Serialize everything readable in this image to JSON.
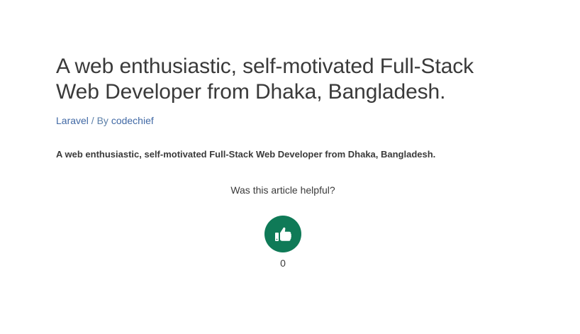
{
  "article": {
    "title": "A web enthusiastic, self-motivated Full-Stack Web Developer from Dhaka, Bangladesh.",
    "category": "Laravel",
    "separator": " / By ",
    "author": "codechief",
    "excerpt": "A web enthusiastic, self-motivated Full-Stack Web Developer from Dhaka, Bangladesh."
  },
  "feedback": {
    "question": "Was this article helpful?",
    "icon": "thumbs-up-icon",
    "count": "0",
    "button_color": "#0f7a57"
  },
  "colors": {
    "link": "#4169a5",
    "text": "#3a3a3a"
  }
}
